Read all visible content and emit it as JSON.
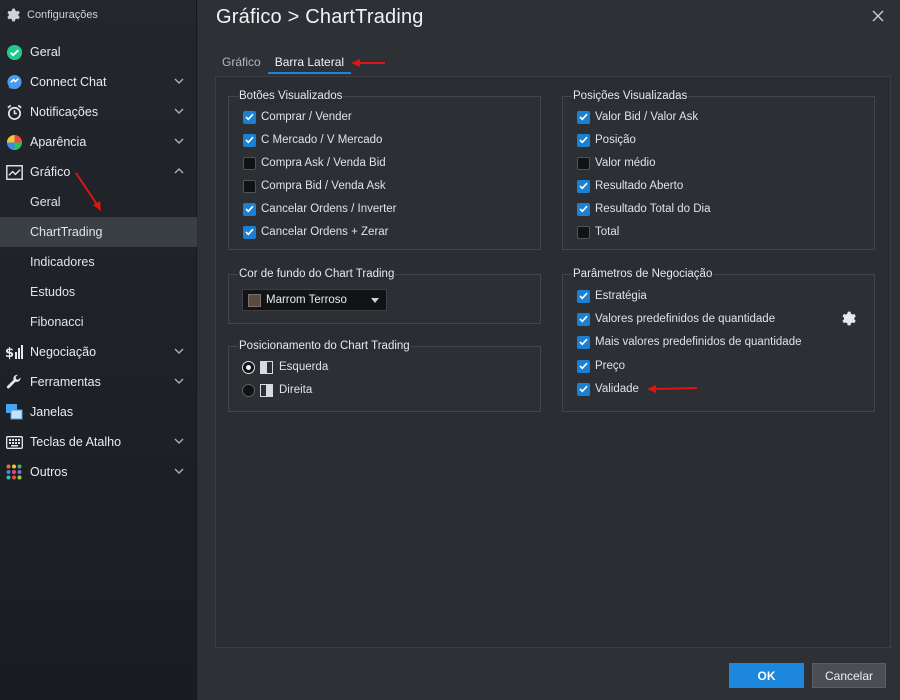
{
  "sidebar": {
    "header": "Configurações",
    "items": [
      {
        "label": "Geral"
      },
      {
        "label": "Connect Chat"
      },
      {
        "label": "Notificações"
      },
      {
        "label": "Aparência"
      },
      {
        "label": "Gráfico"
      },
      {
        "label": "Geral"
      },
      {
        "label": "ChartTrading"
      },
      {
        "label": "Indicadores"
      },
      {
        "label": "Estudos"
      },
      {
        "label": "Fibonacci"
      },
      {
        "label": "Negociação"
      },
      {
        "label": "Ferramentas"
      },
      {
        "label": "Janelas"
      },
      {
        "label": "Teclas de Atalho"
      },
      {
        "label": "Outros"
      }
    ]
  },
  "header": {
    "title": "Gráfico > ChartTrading"
  },
  "tabs": [
    {
      "label": "Gráfico"
    },
    {
      "label": "Barra Lateral"
    }
  ],
  "botoes": {
    "title": "Botões Visualizados",
    "items": [
      {
        "label": "Comprar / Vender",
        "checked": true
      },
      {
        "label": "C Mercado / V Mercado",
        "checked": true
      },
      {
        "label": "Compra Ask /  Venda Bid",
        "checked": false
      },
      {
        "label": "Compra Bid / Venda Ask",
        "checked": false
      },
      {
        "label": "Cancelar Ordens / Inverter",
        "checked": true
      },
      {
        "label": "Cancelar Ordens + Zerar",
        "checked": true
      }
    ]
  },
  "posicoes": {
    "title": "Posições Visualizadas",
    "items": [
      {
        "label": "Valor Bid / Valor Ask",
        "checked": true
      },
      {
        "label": "Posição",
        "checked": true
      },
      {
        "label": "Valor médio",
        "checked": false
      },
      {
        "label": "Resultado Aberto",
        "checked": true
      },
      {
        "label": "Resultado Total do Dia",
        "checked": true
      },
      {
        "label": "Total",
        "checked": false
      }
    ]
  },
  "cor_fundo": {
    "title": "Cor de fundo do Chart Trading",
    "selected": "Marrom Terroso",
    "swatch_color": "#5a4b42"
  },
  "posicionamento": {
    "title": "Posicionamento do Chart Trading",
    "options": [
      {
        "label": "Esquerda",
        "selected": true
      },
      {
        "label": "Direita",
        "selected": false
      }
    ]
  },
  "parametros": {
    "title": "Parâmetros de Negociação",
    "items": [
      {
        "label": "Estratégia",
        "checked": true
      },
      {
        "label": "Valores predefinidos de quantidade",
        "checked": true
      },
      {
        "label": "Mais valores predefinidos de quantidade",
        "checked": true
      },
      {
        "label": "Preço",
        "checked": true
      },
      {
        "label": "Validade",
        "checked": true
      }
    ]
  },
  "footer": {
    "ok_label": "OK",
    "cancel_label": "Cancelar"
  },
  "colors": {
    "accent": "#1c80d2",
    "annotation": "#e01414"
  }
}
